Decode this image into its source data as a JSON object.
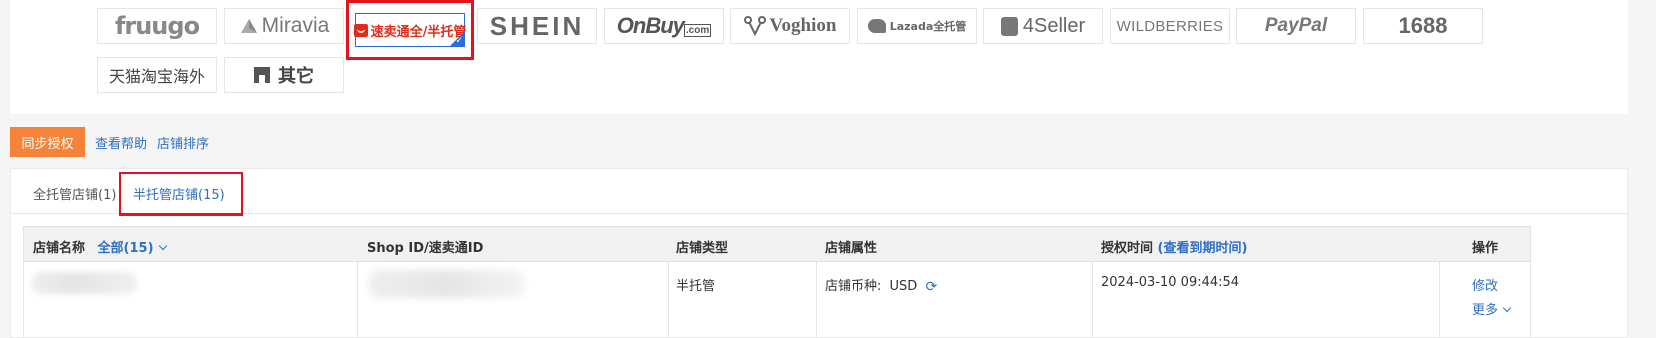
{
  "platforms": {
    "fruugo": "fruugo",
    "miravia": "Miravia",
    "aliexpress": "速卖通全/半托管",
    "shein": "SHEIN",
    "onbuy": "OnBuy",
    "onbuy_suffix": ".com",
    "voghion": "Voghion",
    "lazada": "Lazada全托管",
    "fourseller": "4Seller",
    "wildberries": "WILDBERRIES",
    "paypal": "PayPal",
    "p1688": "1688",
    "tmall": "天猫淘宝海外",
    "other": "其它"
  },
  "actions": {
    "sync_button": "同步授权",
    "help_link": "查看帮助",
    "sort_link": "店铺排序"
  },
  "tabs": {
    "full": "全托管店铺(1)",
    "semi": "半托管店铺(15)"
  },
  "table": {
    "headers": {
      "name": "店铺名称",
      "filter": "全部(15)",
      "shop_id": "Shop ID/速卖通ID",
      "type": "店铺类型",
      "attr": "店铺属性",
      "auth_time": "授权时间",
      "auth_link": "(查看到期时间)",
      "ops": "操作"
    },
    "rows": [
      {
        "type": "半托管",
        "currency_label": "店铺币种:",
        "currency": "USD",
        "auth_time": "2024-03-10 09:44:54",
        "edit": "修改",
        "more": "更多"
      }
    ]
  }
}
